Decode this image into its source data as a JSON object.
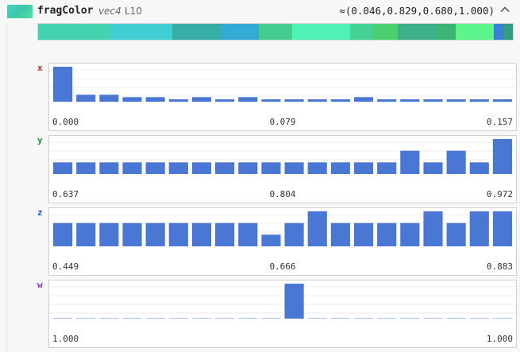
{
  "header": {
    "name": "fragColor",
    "type": "vec4",
    "line": "L10",
    "value": "≈(0.046,0.829,0.680,1.000)"
  },
  "swatch_color": "#47d0c0",
  "color_stripe": [
    {
      "color": "#45d2ae",
      "weight": 15
    },
    {
      "color": "#41cfd4",
      "weight": 13
    },
    {
      "color": "#36aea6",
      "weight": 10
    },
    {
      "color": "#35a9d6",
      "weight": 8
    },
    {
      "color": "#47cc8f",
      "weight": 7
    },
    {
      "color": "#4ff2b4",
      "weight": 12
    },
    {
      "color": "#43d195",
      "weight": 5
    },
    {
      "color": "#4ccf6e",
      "weight": 5
    },
    {
      "color": "#3fae8a",
      "weight": 8
    },
    {
      "color": "#3bb474",
      "weight": 4
    },
    {
      "color": "#5cf58c",
      "weight": 8
    },
    {
      "color": "#3b7fd6",
      "weight": 2
    },
    {
      "color": "#2f9e86",
      "weight": 2
    }
  ],
  "components": [
    {
      "label": "x",
      "color": "#cc2222",
      "min": "0.000",
      "mid": "0.079",
      "max": "0.157",
      "values": [
        10,
        2,
        2,
        1.3,
        1.3,
        0.7,
        1.3,
        0.7,
        1.3,
        0.7,
        0.7,
        0.7,
        0.7,
        1.3,
        0.7,
        0.7,
        0.7,
        0.7,
        0.7,
        0.7
      ]
    },
    {
      "label": "y",
      "color": "#2a8a2a",
      "min": "0.637",
      "mid": "0.804",
      "max": "0.972",
      "values": [
        1,
        1,
        1,
        1,
        1,
        1,
        1,
        1,
        1,
        1,
        1,
        1,
        1,
        1,
        1,
        2,
        1,
        2,
        1,
        3
      ]
    },
    {
      "label": "z",
      "color": "#2255cc",
      "min": "0.449",
      "mid": "0.666",
      "max": "0.883",
      "values": [
        2,
        2,
        2,
        2,
        2,
        2,
        2,
        2,
        2,
        1,
        2,
        3,
        2,
        2,
        2,
        2,
        3,
        2,
        3,
        3
      ]
    },
    {
      "label": "w",
      "color": "#7a3aa8",
      "min": "1.000",
      "mid": "",
      "max": "1.000",
      "values": [
        0,
        0,
        0,
        0,
        0,
        0,
        0,
        0,
        0,
        0,
        1,
        0,
        0,
        0,
        0,
        0,
        0,
        0,
        0,
        0
      ]
    }
  ],
  "bar_color": "#4a77d4",
  "baseline_color": "#a9bde8"
}
